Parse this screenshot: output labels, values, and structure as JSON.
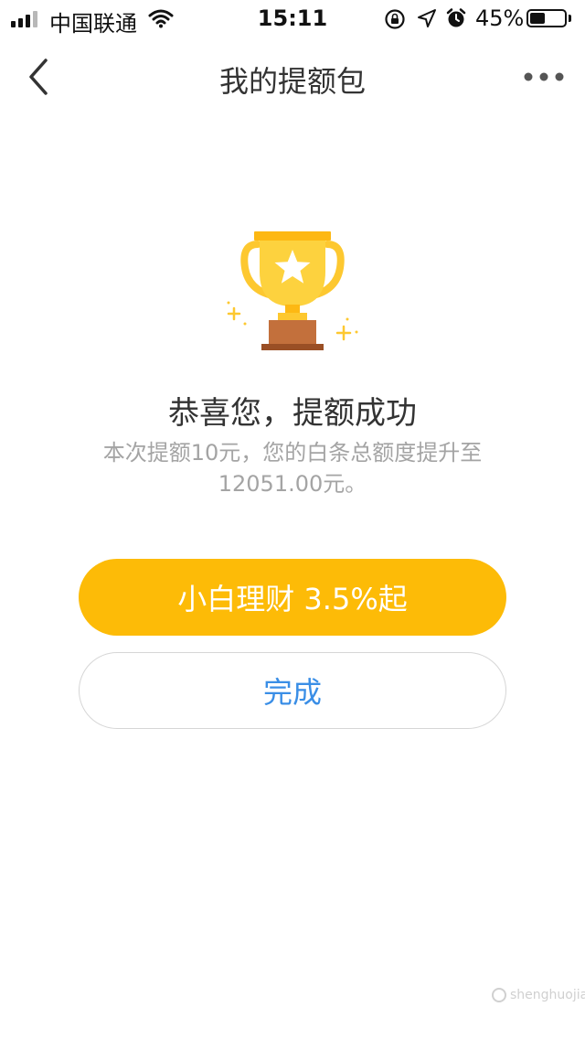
{
  "status_bar": {
    "carrier": "中国联通",
    "time": "15:11",
    "battery_percent_text": "45%",
    "battery_level": 0.45,
    "signal_bars_active": 3,
    "signal_bars_total": 4
  },
  "nav": {
    "title": "我的提额包",
    "back_icon": "chevron-left-icon",
    "more_icon": "more-dots-icon"
  },
  "result": {
    "icon": "trophy-icon",
    "title": "恭喜您，提额成功",
    "description": "本次提额10元，您的白条总额度提升至12051.00元。"
  },
  "buttons": {
    "primary_label": "小白理财 3.5%起",
    "done_label": "完成"
  },
  "watermark": {
    "text": "shenghuojiaxin"
  },
  "colors": {
    "accent": "#fdbb07",
    "link": "#3a8ee6",
    "trophy_gold": "#fdc830",
    "trophy_base": "#c3703c"
  }
}
